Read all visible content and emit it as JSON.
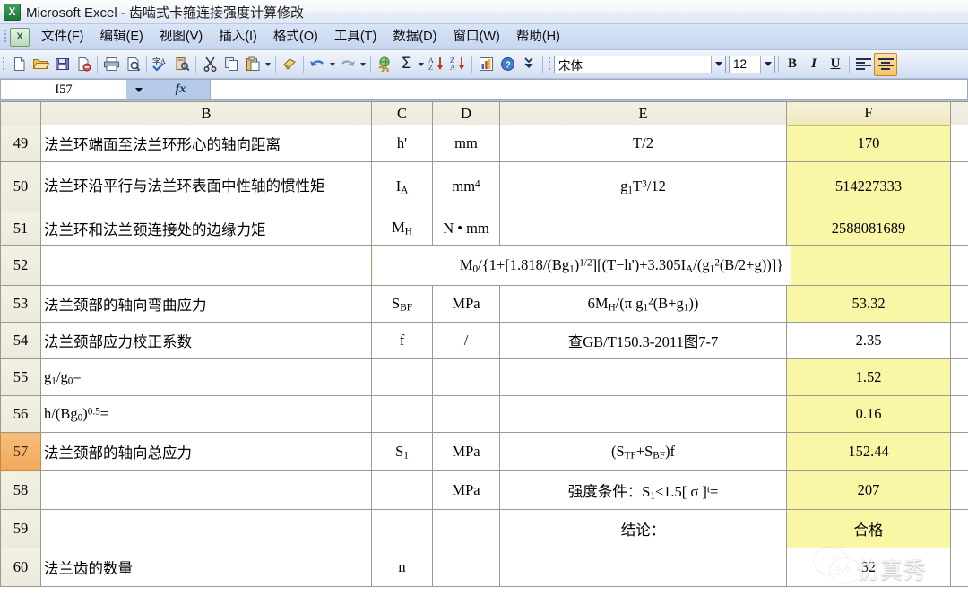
{
  "window": {
    "title": "Microsoft Excel - 齿啮式卡箍连接强度计算修改",
    "app_icon": "excel-logo-icon"
  },
  "menubar": {
    "items": [
      {
        "label": "文件(F)"
      },
      {
        "label": "编辑(E)"
      },
      {
        "label": "视图(V)"
      },
      {
        "label": "插入(I)"
      },
      {
        "label": "格式(O)"
      },
      {
        "label": "工具(T)"
      },
      {
        "label": "数据(D)"
      },
      {
        "label": "窗口(W)"
      },
      {
        "label": "帮助(H)"
      }
    ]
  },
  "toolbar": {
    "standard_icons": [
      "new-icon",
      "open-icon",
      "save-icon",
      "permission-icon",
      "print-icon",
      "print-preview-icon",
      "spelling-icon",
      "research-icon",
      "cut-icon",
      "copy-icon",
      "paste-icon",
      "format-painter-icon",
      "undo-icon",
      "redo-icon",
      "hyperlink-icon",
      "autosum-icon",
      "sort-ascending-icon",
      "sort-descending-icon",
      "chart-wizard-icon",
      "help-icon",
      "toolbar-options-icon"
    ],
    "font_name": "宋体",
    "font_size": "12",
    "bold_label": "B",
    "italic_label": "I",
    "underline_label": "U",
    "align_left_icon": "align-left-icon",
    "align_center_icon": "align-center-icon",
    "align_center_active": true
  },
  "formula_bar": {
    "name_box": "I57",
    "fx_label": "fx",
    "formula_value": ""
  },
  "sheet": {
    "column_headers": [
      "B",
      "C",
      "D",
      "E",
      "F"
    ],
    "selected_column": "F",
    "selected_row": "57",
    "rows": [
      {
        "num": "49",
        "B": "法兰环端面至法兰环形心的轴向距离",
        "C": "h'",
        "D": "mm",
        "E": "T/2",
        "F": "170",
        "F_highlight": true
      },
      {
        "num": "50",
        "B": "法兰环沿平行与法兰环表面中性轴的惯性矩",
        "C": "I_A",
        "D": "mm^4",
        "E": "g1·T^3/12",
        "F": "514227333",
        "F_highlight": true
      },
      {
        "num": "51",
        "B": "法兰环和法兰颈连接处的边缘力矩",
        "C": "M_H",
        "D": "N • mm",
        "E": "",
        "F": "2588081689",
        "F_highlight": true
      },
      {
        "num": "52",
        "B": "",
        "C": "",
        "D": "",
        "E": "M0/{1+[1.818/(Bg1)^(1/2)][(T-h')+3.305·I_A/(g1^2·(B/2+g))]}",
        "F": "",
        "F_highlight": true,
        "merged_formula": true
      },
      {
        "num": "53",
        "B": "法兰颈部的轴向弯曲应力",
        "C": "S_BF",
        "D": "MPa",
        "E": "6M_H/(π g1^2 (B+g1))",
        "F": "53.32",
        "F_highlight": true
      },
      {
        "num": "54",
        "B": "法兰颈部应力校正系数",
        "C": "f",
        "D": "/",
        "E": "查GB/T150.3-2011图7-7",
        "F": "2.35",
        "F_highlight": false
      },
      {
        "num": "55",
        "B": "g1/g0=",
        "C": "",
        "D": "",
        "E": "",
        "F": "1.52",
        "F_highlight": true
      },
      {
        "num": "56",
        "B": "h/(Bg0)^0.5=",
        "C": "",
        "D": "",
        "E": "",
        "F": "0.16",
        "F_highlight": true
      },
      {
        "num": "57",
        "B": "法兰颈部的轴向总应力",
        "C": "S_1",
        "D": "MPa",
        "E": "(S_TF+S_BF)f",
        "F": "152.44",
        "F_highlight": true
      },
      {
        "num": "58",
        "B": "",
        "C": "",
        "D": "MPa",
        "E": "强度条件：S1≤1.5[σ]^t=",
        "F": "207",
        "F_highlight": true
      },
      {
        "num": "59",
        "B": "",
        "C": "",
        "D": "",
        "E": "结论：",
        "F": "合格",
        "F_highlight": true,
        "F_color": "#d73a0a"
      },
      {
        "num": "60",
        "B": "法兰齿的数量",
        "C": "n",
        "D": "",
        "E": "",
        "F": "32",
        "F_highlight": false
      }
    ]
  },
  "watermark": {
    "text": "仿真秀",
    "icon": "wechat-bubbles-icon"
  }
}
